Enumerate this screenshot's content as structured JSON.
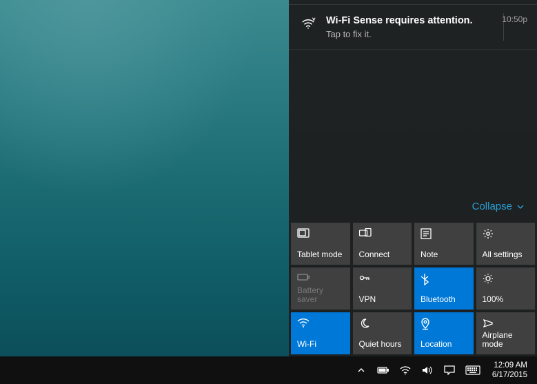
{
  "notification": {
    "title": "Wi-Fi Sense requires attention.",
    "subtitle": "Tap to fix it.",
    "time": "10:50p",
    "icon": "wifi-sense-icon"
  },
  "collapse_label": "Collapse",
  "quick_actions": [
    {
      "label": "Tablet mode",
      "icon": "tablet-icon",
      "state": "normal"
    },
    {
      "label": "Connect",
      "icon": "connect-icon",
      "state": "normal"
    },
    {
      "label": "Note",
      "icon": "note-icon",
      "state": "normal"
    },
    {
      "label": "All settings",
      "icon": "settings-icon",
      "state": "normal"
    },
    {
      "label": "Battery saver",
      "icon": "battery-icon",
      "state": "disabled"
    },
    {
      "label": "VPN",
      "icon": "vpn-icon",
      "state": "normal"
    },
    {
      "label": "Bluetooth",
      "icon": "bluetooth-icon",
      "state": "active"
    },
    {
      "label": "100%",
      "icon": "brightness-icon",
      "state": "normal"
    },
    {
      "label": "Wi-Fi",
      "icon": "wifi-icon",
      "state": "active"
    },
    {
      "label": "Quiet hours",
      "icon": "quiet-icon",
      "state": "normal"
    },
    {
      "label": "Location",
      "icon": "location-icon",
      "state": "active"
    },
    {
      "label": "Airplane mode",
      "icon": "airplane-icon",
      "state": "normal"
    }
  ],
  "taskbar": {
    "time": "12:09 AM",
    "date": "6/17/2015",
    "icons": [
      "chevron-up-icon",
      "battery-icon",
      "wifi-icon",
      "volume-icon",
      "action-center-icon",
      "keyboard-icon"
    ]
  },
  "colors": {
    "accent": "#0078d7",
    "link": "#2a9fd6",
    "panel": "#1e1e1e",
    "tile": "#404040"
  }
}
